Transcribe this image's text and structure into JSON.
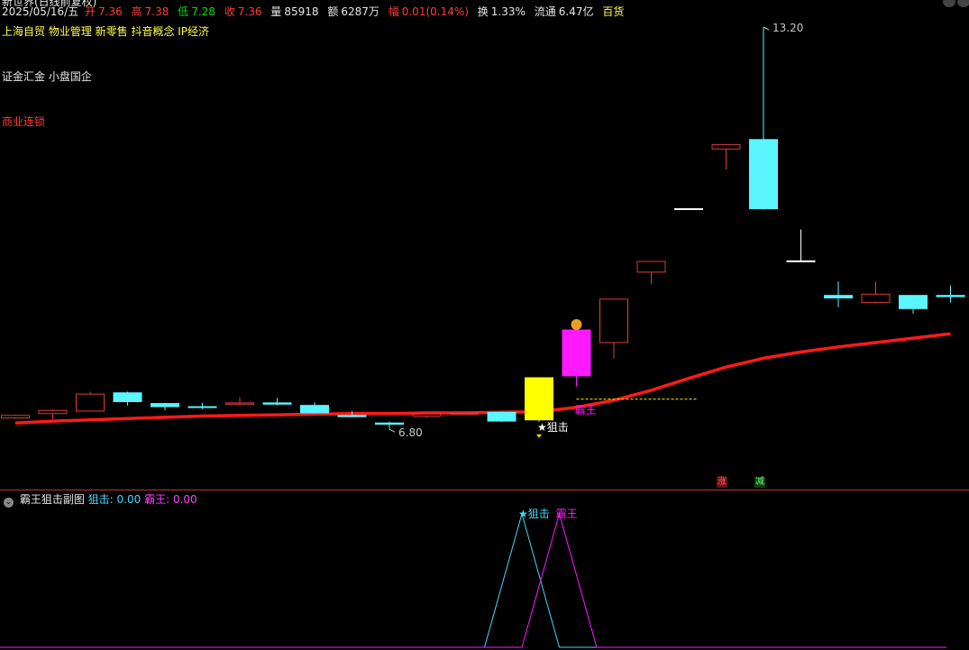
{
  "header": {
    "line0": "新世界(日线前复权)",
    "date": "2025/05/16/五",
    "open_label": "开",
    "open": "7.36",
    "high_label": "高",
    "high": "7.38",
    "low_label": "低",
    "low": "7.28",
    "close_label": "收",
    "close": "7.36",
    "vol_label": "量",
    "vol": "85918",
    "amt_label": "额",
    "amt": "6287万",
    "chg_label": "幅",
    "chg": "0.01(0.14%)",
    "turn_label": "换",
    "turn": "1.33%",
    "float_label": "流通",
    "float": "6.47亿",
    "sector": "百货"
  },
  "concepts": {
    "line1": "上海自贸 物业管理 新零售 抖音概念 IP经济",
    "line2": "证金汇金 小盘国企",
    "line3": "商业连锁"
  },
  "sub_header": {
    "title": "霸王狙击副图",
    "snipe_label": "狙击:",
    "snipe_value": "0.00",
    "king_label": "霸王:",
    "king_value": "0.00"
  },
  "badges": {
    "zhang": "涨",
    "jian": "减"
  },
  "colors": {
    "up": "#e03c3c",
    "down": "#5af5ff",
    "ma": "#ff1a1a",
    "signal_yellow": "#ffff00",
    "signal_magenta": "#ff1aff"
  },
  "chart_data": {
    "type": "candlestick",
    "price_range": [
      6.5,
      13.5
    ],
    "candles": [
      {
        "o": 6.98,
        "c": 7.02,
        "h": 7.03,
        "l": 6.97,
        "color": "up"
      },
      {
        "o": 7.05,
        "c": 7.1,
        "h": 7.12,
        "l": 6.96,
        "color": "up"
      },
      {
        "o": 7.09,
        "c": 7.36,
        "h": 7.4,
        "l": 7.08,
        "color": "up"
      },
      {
        "o": 7.38,
        "c": 7.24,
        "h": 7.4,
        "l": 7.18,
        "color": "down"
      },
      {
        "o": 7.21,
        "c": 7.16,
        "h": 7.22,
        "l": 7.1,
        "color": "down"
      },
      {
        "o": 7.16,
        "c": 7.16,
        "h": 7.22,
        "l": 7.12,
        "color": "down"
      },
      {
        "o": 7.2,
        "c": 7.22,
        "h": 7.31,
        "l": 7.18,
        "color": "up"
      },
      {
        "o": 7.22,
        "c": 7.2,
        "h": 7.3,
        "l": 7.18,
        "color": "down"
      },
      {
        "o": 7.18,
        "c": 7.06,
        "h": 7.23,
        "l": 7.05,
        "color": "down"
      },
      {
        "o": 7.02,
        "c": 7.0,
        "h": 7.09,
        "l": 6.99,
        "color": "down"
      },
      {
        "o": 6.9,
        "c": 6.88,
        "h": 6.92,
        "l": 6.8,
        "color": "down"
      },
      {
        "o": 7.01,
        "c": 7.05,
        "h": 7.06,
        "l": 6.99,
        "color": "up"
      },
      {
        "o": 7.04,
        "c": 7.06,
        "h": 7.07,
        "l": 7.03,
        "color": "up"
      },
      {
        "o": 7.07,
        "c": 6.93,
        "h": 7.08,
        "l": 6.92,
        "color": "down"
      },
      {
        "o": 6.95,
        "c": 7.62,
        "h": 7.62,
        "l": 6.92,
        "color": "yellow"
      },
      {
        "o": 7.65,
        "c": 8.38,
        "h": 8.38,
        "l": 7.48,
        "color": "magenta"
      },
      {
        "o": 8.18,
        "c": 8.87,
        "h": 8.87,
        "l": 7.93,
        "color": "up"
      },
      {
        "o": 9.3,
        "c": 9.47,
        "h": 9.47,
        "l": 9.11,
        "color": "up"
      },
      {
        "o": 10.31,
        "c": 10.31,
        "h": 10.31,
        "l": 10.31,
        "color": "flat"
      },
      {
        "o": 11.26,
        "c": 11.33,
        "h": 11.33,
        "l": 10.93,
        "color": "up"
      },
      {
        "o": 11.41,
        "c": 10.31,
        "h": 13.2,
        "l": 10.29,
        "color": "down"
      },
      {
        "o": 9.48,
        "c": 9.48,
        "h": 9.98,
        "l": 9.48,
        "color": "flat"
      },
      {
        "o": 8.93,
        "c": 8.89,
        "h": 9.15,
        "l": 8.74,
        "color": "down"
      },
      {
        "o": 8.82,
        "c": 8.95,
        "h": 9.15,
        "l": 8.8,
        "color": "up"
      },
      {
        "o": 8.93,
        "c": 8.72,
        "h": 8.93,
        "l": 8.64,
        "color": "down"
      },
      {
        "o": 8.93,
        "c": 8.91,
        "h": 9.09,
        "l": 8.82,
        "color": "down"
      }
    ],
    "ma": [
      6.9,
      6.93,
      6.95,
      6.97,
      6.99,
      7.01,
      7.02,
      7.03,
      7.04,
      7.05,
      7.05,
      7.06,
      7.06,
      7.07,
      7.08,
      7.15,
      7.26,
      7.42,
      7.61,
      7.79,
      7.93,
      8.03,
      8.11,
      8.18,
      8.25,
      8.32
    ],
    "max_label": "13.20",
    "min_label": "6.80",
    "signal_labels": {
      "snipe": "狙击",
      "king": "霸王"
    },
    "sub_chart": {
      "range": [
        0,
        1
      ],
      "snipe": [
        0,
        0,
        0,
        0,
        0,
        0,
        0,
        0,
        0,
        0,
        0,
        0,
        0,
        0,
        1,
        0,
        0,
        0,
        0,
        0,
        0,
        0,
        0,
        0,
        0,
        0
      ],
      "king": [
        0,
        0,
        0,
        0,
        0,
        0,
        0,
        0,
        0,
        0,
        0,
        0,
        0,
        0,
        0,
        1,
        0,
        0,
        0,
        0,
        0,
        0,
        0,
        0,
        0,
        0
      ]
    }
  }
}
